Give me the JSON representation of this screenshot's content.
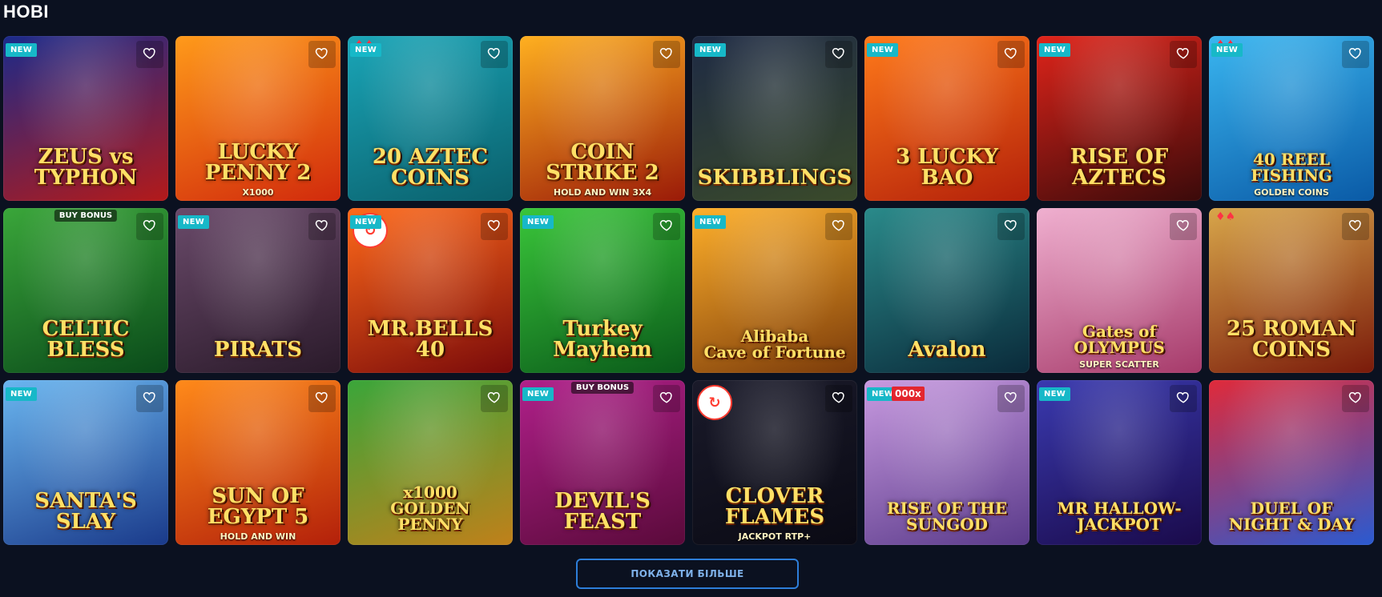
{
  "section": {
    "title": "НОВІ"
  },
  "more_button": {
    "label": "ПОКАЗАТИ БІЛЬШЕ"
  },
  "favorite_icon": "heart-outline-icon",
  "accent": {
    "new_badge": "#17b8c8",
    "button_border": "#2d7ed9",
    "multiplier_badge": "#e3262e",
    "background": "#0b1120"
  },
  "games": [
    {
      "name": "zeus-vs-typhon",
      "title": "ZEUS vs\nTYPHON",
      "subtitle": "",
      "badge": "NEW",
      "extra": "",
      "bg": [
        "#1b2a8a",
        "#b31a1a"
      ]
    },
    {
      "name": "lucky-penny-2",
      "title": "LUCKY\nPENNY 2",
      "subtitle": "X1000",
      "badge": "",
      "extra": "",
      "bg": [
        "#ff9a1a",
        "#d12a0c"
      ]
    },
    {
      "name": "20-aztec-coins",
      "title": "20 AZTEC\nCOINS",
      "subtitle": "",
      "badge": "NEW",
      "extra": "suits",
      "bg": [
        "#1aa6b8",
        "#0a5f6b"
      ]
    },
    {
      "name": "coin-strike-2",
      "title": "COIN\nSTRIKE 2",
      "subtitle": "HOLD AND WIN 3X4",
      "badge": "",
      "extra": "",
      "bg": [
        "#ffb020",
        "#9a1a08"
      ]
    },
    {
      "name": "skibblings",
      "title": "SKIBBLINGS",
      "subtitle": "",
      "badge": "NEW",
      "extra": "",
      "bg": [
        "#1e2a44",
        "#3a4a2a"
      ]
    },
    {
      "name": "3-lucky-bao",
      "title": "3 LUCKY\nBAO",
      "subtitle": "",
      "badge": "NEW",
      "extra": "",
      "bg": [
        "#ff7a1a",
        "#b3200a"
      ]
    },
    {
      "name": "rise-of-aztecs",
      "title": "RISE OF\nAZTECS",
      "subtitle": "",
      "badge": "NEW",
      "extra": "",
      "bg": [
        "#e0241a",
        "#3a0a0a"
      ]
    },
    {
      "name": "40-golden-coins-reel-fishing",
      "title": "40 REEL FISHING",
      "subtitle": "GOLDEN COINS",
      "badge": "NEW",
      "extra": "suits",
      "bg": [
        "#3ab6f0",
        "#0a5aa6"
      ]
    },
    {
      "name": "celtic-bless",
      "title": "CELTIC BLESS",
      "subtitle": "",
      "badge": "",
      "extra": "buy",
      "bg": [
        "#3aa63a",
        "#0a4a1a"
      ]
    },
    {
      "name": "pirats",
      "title": "PIRATS",
      "subtitle": "",
      "badge": "NEW",
      "extra": "",
      "bg": [
        "#6a4a6a",
        "#2a1a2a"
      ]
    },
    {
      "name": "mr-bells-40",
      "title": "MR.BELLS 40",
      "subtitle": "",
      "badge": "NEW",
      "extra": "provider",
      "bg": [
        "#ff6a1a",
        "#7a0a0a"
      ]
    },
    {
      "name": "turkey-mayhem",
      "title": "Turkey Mayhem",
      "subtitle": "",
      "badge": "NEW",
      "extra": "",
      "bg": [
        "#3ac63a",
        "#0a5a1a"
      ]
    },
    {
      "name": "alibaba-cave-of-fortune",
      "title": "Alibaba\nCave of Fortune",
      "subtitle": "",
      "badge": "NEW",
      "extra": "",
      "bg": [
        "#ffb02a",
        "#7a3a0a"
      ]
    },
    {
      "name": "avalon",
      "title": "Avalon",
      "subtitle": "",
      "badge": "",
      "extra": "",
      "bg": [
        "#2a8a8a",
        "#0a2a3a"
      ]
    },
    {
      "name": "gates-of-olympus-super-scatter",
      "title": "Gates of\nOLYMPUS",
      "subtitle": "SUPER SCATTER",
      "badge": "",
      "extra": "",
      "bg": [
        "#f0b0d0",
        "#a63a6a"
      ]
    },
    {
      "name": "25-roman-coins",
      "title": "25 ROMAN COINS",
      "subtitle": "",
      "badge": "",
      "extra": "suits",
      "bg": [
        "#d8a64a",
        "#7a1a0a"
      ]
    },
    {
      "name": "santas-slay",
      "title": "SANTA'S\nSLAY",
      "subtitle": "",
      "badge": "NEW",
      "extra": "",
      "bg": [
        "#6ab6f0",
        "#1a3a8a"
      ]
    },
    {
      "name": "sun-of-egypt-5",
      "title": "SUN OF\nEGYPT 5",
      "subtitle": "HOLD AND WIN",
      "badge": "",
      "extra": "",
      "bg": [
        "#ff8a1a",
        "#b3200a"
      ]
    },
    {
      "name": "1000-golden-penny",
      "title": "x1000\nGOLDEN\nPENNY",
      "subtitle": "",
      "badge": "",
      "extra": "",
      "bg": [
        "#3aa63a",
        "#c0801a"
      ]
    },
    {
      "name": "devils-feast",
      "title": "DEVIL'S FEAST",
      "subtitle": "",
      "badge": "NEW",
      "extra": "buy",
      "bg": [
        "#b0208a",
        "#5a0a3a"
      ]
    },
    {
      "name": "clover-flames",
      "title": "CLOVER\nFLAMES",
      "subtitle": "JACKPOT RTP+",
      "badge": "",
      "extra": "provider",
      "bg": [
        "#1a1a2a",
        "#0a0a14"
      ]
    },
    {
      "name": "rise-of-the-sun-god",
      "title": "RISE OF THE\nSUNGOD",
      "subtitle": "",
      "badge": "NEW",
      "extra": "multi",
      "bg": [
        "#c89ae0",
        "#5a3a8a"
      ]
    },
    {
      "name": "mr-hallow-jackpot",
      "title": "MR HALLOW-JACKPOT",
      "subtitle": "",
      "badge": "NEW",
      "extra": "",
      "bg": [
        "#3a3ab0",
        "#1a0a4a"
      ]
    },
    {
      "name": "duel-of-night-and-day",
      "title": "DUEL OF\nNIGHT & DAY",
      "subtitle": "",
      "badge": "",
      "extra": "",
      "bg": [
        "#e02a3a",
        "#2a5ad0"
      ]
    }
  ],
  "buy_bonus_label": "BUY BONUS",
  "multiplier_label": "000x"
}
